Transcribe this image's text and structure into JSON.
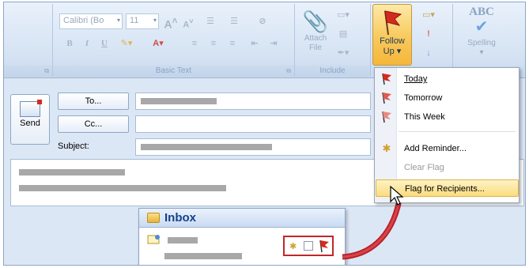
{
  "ribbon": {
    "font_name": "Calibri (Bo",
    "font_size": "11",
    "bold": "B",
    "italic": "I",
    "underline": "U",
    "grow_font": "A",
    "shrink_font": "A",
    "basic_text_label": "Basic Text",
    "include_label": "Include",
    "attach_file_line1": "Attach",
    "attach_file_line2": "File",
    "follow_up_line1": "Follow",
    "follow_up_line2": "Up",
    "spelling_abc": "ABC",
    "spelling_label": "Spelling"
  },
  "compose": {
    "send_label": "Send",
    "to_label": "To...",
    "cc_label": "Cc...",
    "subject_label": "Subject:"
  },
  "menu": {
    "items": [
      {
        "label": "Today"
      },
      {
        "label": "Tomorrow"
      },
      {
        "label": "This Week"
      },
      {
        "label": "Add Reminder..."
      },
      {
        "label": "Clear Flag"
      },
      {
        "label": "Flag for Recipients..."
      }
    ]
  },
  "inbox": {
    "title": "Inbox"
  },
  "colors": {
    "flag_red": "#c0272d",
    "highlight": "#fbdc7e",
    "header_blue": "#15428b"
  }
}
